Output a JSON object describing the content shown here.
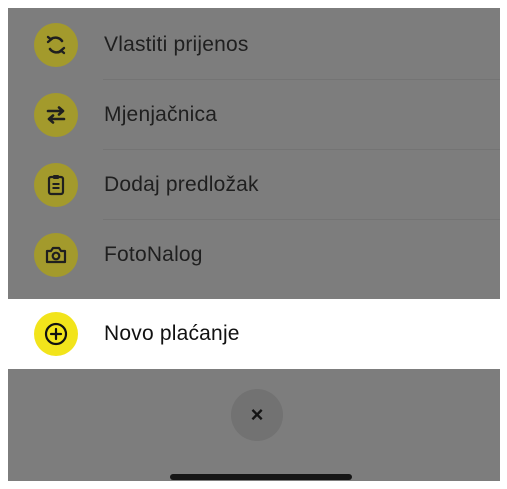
{
  "menu": {
    "items": [
      {
        "label": "Vlastiti prijenos",
        "icon": "refresh-icon"
      },
      {
        "label": "Mjenjačnica",
        "icon": "exchange-arrows-icon"
      },
      {
        "label": "Dodaj predložak",
        "icon": "clipboard-icon"
      },
      {
        "label": "FotoNalog",
        "icon": "camera-icon"
      },
      {
        "label": "Novo plaćanje",
        "icon": "plus-circle-icon"
      }
    ],
    "close_label": "×"
  },
  "colors": {
    "overlay": "#7d7d7d",
    "accent_yellow": "#f2e41b",
    "dimmed_yellow": "#a39a2c",
    "active_row": "#ffffff"
  }
}
